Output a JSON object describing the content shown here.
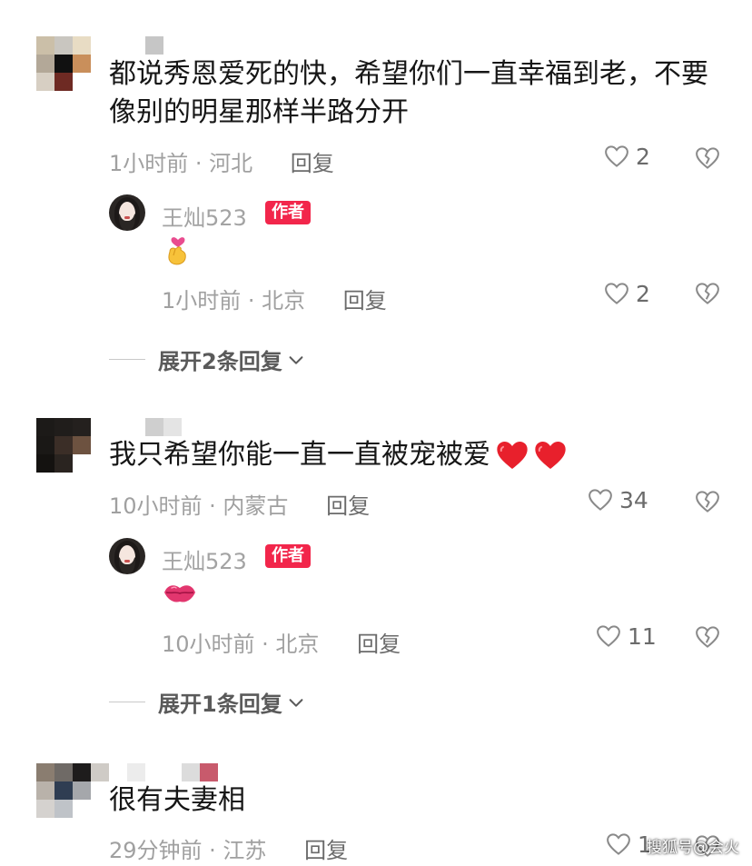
{
  "comments": [
    {
      "text_line1": "都说秀恩爱死的快，希望你们一直幸福到老，不要",
      "text_line2": "像别的明星那样半路分开",
      "time_location": "1小时前 · 河北",
      "reply_label": "回复",
      "likes": "2",
      "author_reply": {
        "name": "王灿523",
        "badge": "作者",
        "emoji": "finger-heart",
        "time_location": "1小时前 · 北京",
        "reply_label": "回复",
        "likes": "2"
      },
      "expand_label": "展开2条回复"
    },
    {
      "text": "我只希望你能一直一直被宠被爱",
      "time_location": "10小时前 · 内蒙古",
      "reply_label": "回复",
      "likes": "34",
      "author_reply": {
        "name": "王灿523",
        "badge": "作者",
        "emoji": "kiss-lips",
        "time_location": "10小时前 · 北京",
        "reply_label": "回复",
        "likes": "11"
      },
      "expand_label": "展开1条回复"
    },
    {
      "text": "很有夫妻相",
      "time_location": "29分钟前 · 江苏",
      "reply_label": "回复",
      "likes": "1"
    }
  ],
  "watermark": "搜狐号@会火",
  "colors": {
    "badge_bg": "#f2264b",
    "heart_red": "#e8202c",
    "muted_text": "#a0a0a0",
    "action_text": "#6b6b6b"
  }
}
